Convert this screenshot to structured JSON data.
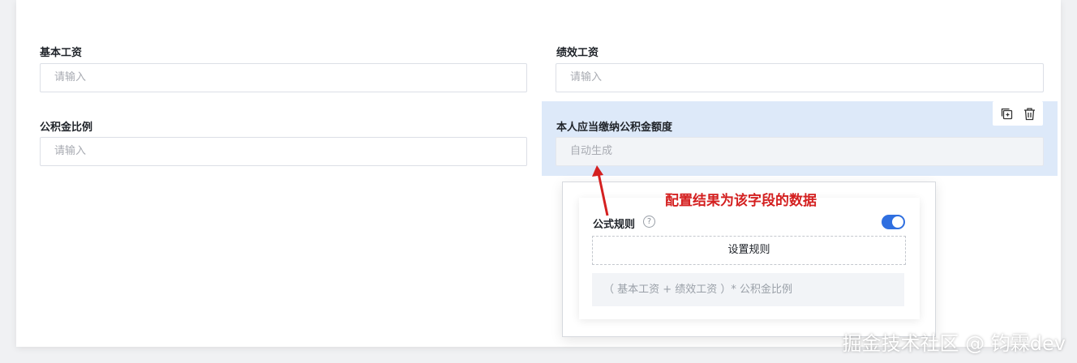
{
  "form": {
    "fields": [
      {
        "label": "基本工资",
        "placeholder": "请输入"
      },
      {
        "label": "绩效工资",
        "placeholder": "请输入"
      },
      {
        "label": "公积金比例",
        "placeholder": "请输入"
      },
      {
        "label": "本人应当缴纳公积金额度",
        "placeholder": "自动生成"
      }
    ]
  },
  "selected_field_actions": {
    "copy_icon": "copy-icon",
    "delete_icon": "trash-icon"
  },
  "popover": {
    "title": "公式规则",
    "help_icon": "?",
    "toggle_on": true,
    "set_rule_label": "设置规则",
    "formula": "（ 基本工资 + 绩效工资 ）* 公积金比例"
  },
  "annotation": "配置结果为该字段的数据",
  "watermark": "掘金技术社区 @ 钧霖dev",
  "colors": {
    "accent": "#2f6fe0",
    "annotation": "#d42020",
    "selected_bg": "#dde9f9"
  }
}
